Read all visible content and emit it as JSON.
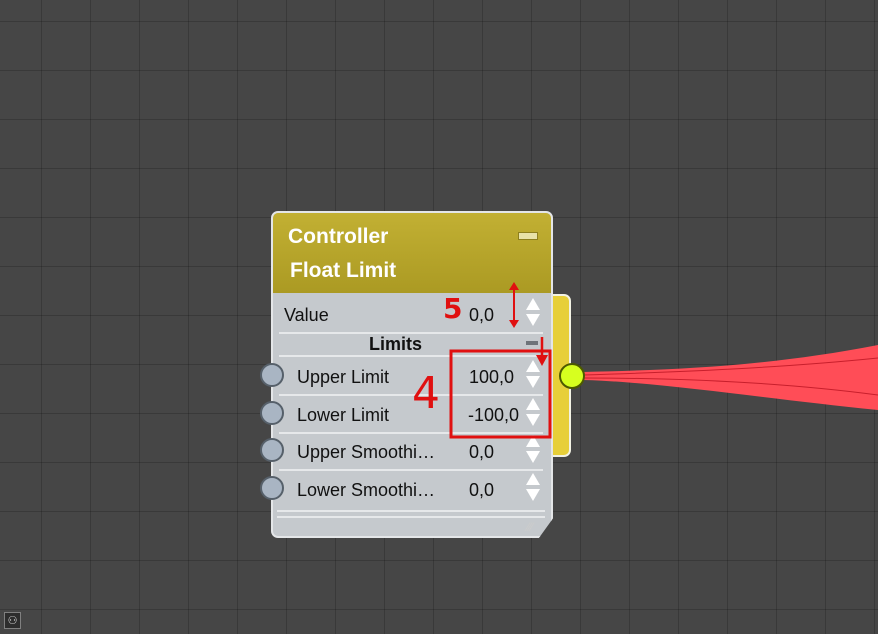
{
  "node": {
    "title_line1": "Controller",
    "title_line2": "Float Limit",
    "value_row": {
      "label": "Value",
      "value": "0,0"
    },
    "section_title": "Limits",
    "rows": [
      {
        "label": "Upper Limit",
        "value": "100,0"
      },
      {
        "label": "Lower Limit",
        "value": "-100,0"
      },
      {
        "label": "Upper  Smoothi…",
        "value": "0,0"
      },
      {
        "label": "Lower  Smoothi…",
        "value": "0,0"
      }
    ]
  },
  "annotations": {
    "five": "5",
    "four": "4"
  },
  "colors": {
    "header": "#b8a52b",
    "node_body": "#c5c9cd",
    "output_tab": "#e7cf39",
    "output_socket": "#d7ff1f",
    "annotation_red": "#e01010",
    "wire": "#ff4d57"
  },
  "icons": {
    "minimize": "minimize-bar-icon",
    "spinner": "spinner-arrows-icon",
    "resize": "resize-grip-icon",
    "status": "binoculars-icon"
  }
}
